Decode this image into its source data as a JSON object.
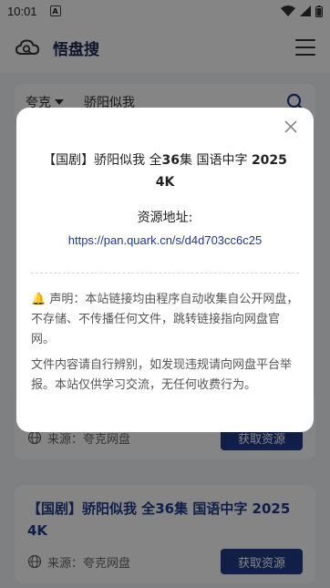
{
  "status_bar": {
    "time": "10:01",
    "notif_icon_letter": "A"
  },
  "header": {
    "title": "悟盘搜"
  },
  "search": {
    "engine": "夸克",
    "query": "骄阳似我"
  },
  "cards": [
    {
      "title": "",
      "source": "来源：夸克网盘",
      "button": "获取资源"
    },
    {
      "title": "【国剧】骄阳似我 全36集 国语中字 2025 4K",
      "source": "来源：夸克网盘",
      "button": "获取资源"
    }
  ],
  "modal": {
    "title_prefix": "【国剧】骄阳似我 全",
    "title_count": "36",
    "title_mid": "集 国语中字 ",
    "title_year": "2025",
    "title_quality": "4K",
    "address_label": "资源地址:",
    "link": "https://pan.quark.cn/s/d4d703cc6c25",
    "notice_1": "声明：本站链接均由程序自动收集自公开网盘，不存储、不传播任何文件，跳转链接指向网盘官网。",
    "notice_2": "文件内容请自行辨别，如发现违规请向网盘平台举报。本站仅供学习交流，无任何收费行为。"
  },
  "colors": {
    "primary": "#1f3a8a",
    "link": "#1f3a8a",
    "bell": "#f5a623"
  }
}
